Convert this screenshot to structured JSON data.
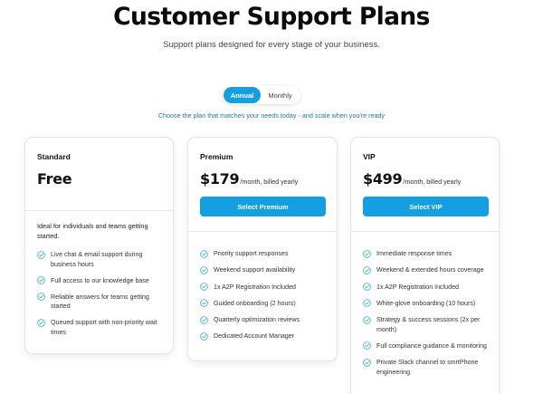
{
  "page": {
    "title": "Customer Support Plans",
    "subtitle": "Support plans designed for every stage of your business."
  },
  "billing_toggle": {
    "annual_label": "Annual",
    "monthly_label": "Monthly",
    "selected": "Annual"
  },
  "choose_text": "Choose the plan that matches your needs today - and scale when you're ready",
  "colors": {
    "accent": "#159fe3",
    "check_icon": "#2ba9d8",
    "link_text": "#2276a6"
  },
  "plans": {
    "standard": {
      "name": "Standard",
      "price": "Free",
      "description": "Ideal for individuals and teams getting started.",
      "features": [
        "Live chat & email support during business hours",
        "Full access to our knowledge base",
        "Reliable answers for teams getting started",
        "Queued support with non-priority wait times"
      ]
    },
    "premium": {
      "name": "Premium",
      "price": "$179",
      "period": "/month, billed yearly",
      "button_label": "Select Premium",
      "features": [
        "Priority support responses",
        "Weekend support availability",
        "1x A2P Registration Included",
        "Guided onboarding (2 hours)",
        "Quarterly optimization reviews",
        "Dedicated Account Manager"
      ]
    },
    "vip": {
      "name": "VIP",
      "price": "$499",
      "period": "/month, billed yearly",
      "button_label": "Select VIP",
      "features": [
        "Immediate response times",
        "Weekend & extended hours coverage",
        "1x A2P Registration Included",
        "White-glove onboarding (10 hours)",
        "Strategy & success sessions (2x per month)",
        "Full compliance guidance & monitoring",
        "Private Slack channel to smrtPhone engineering"
      ]
    }
  }
}
